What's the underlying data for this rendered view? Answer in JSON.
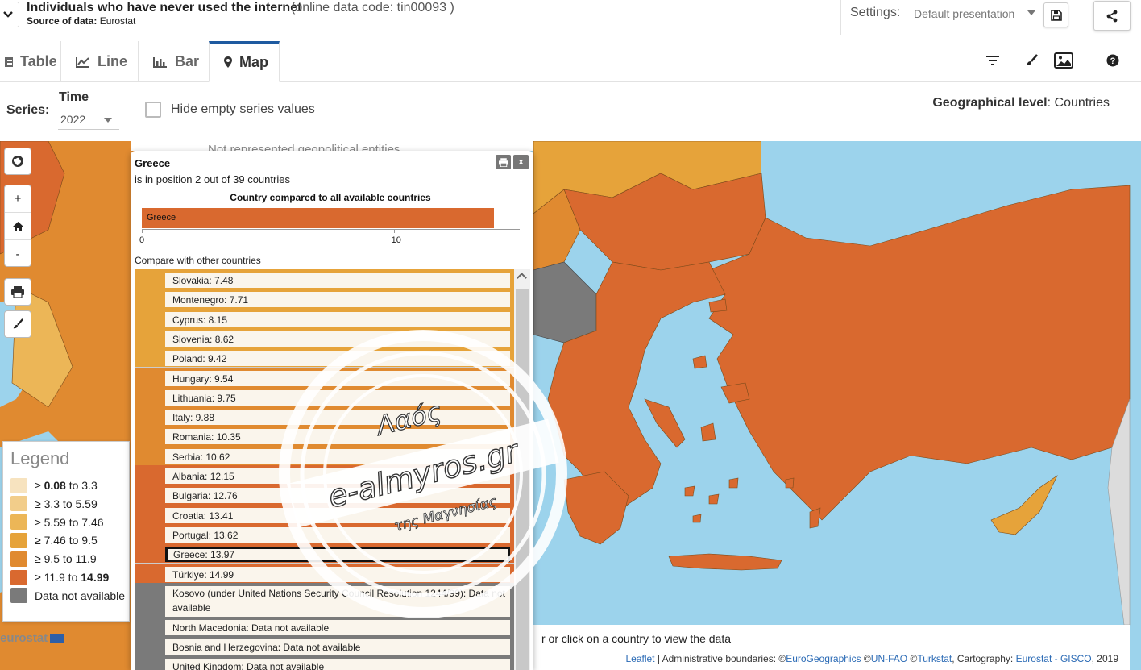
{
  "header": {
    "dataset_title": "Individuals who have never used the internet",
    "dataset_code": "(online data code: tin00093 )",
    "source_label": "Source of data:",
    "source_value": "Eurostat",
    "settings_label": "Settings:",
    "settings_value": "Default presentation"
  },
  "tabs": [
    {
      "label": "Table",
      "icon": "table-icon"
    },
    {
      "label": "Line",
      "icon": "line-chart-icon"
    },
    {
      "label": "Bar",
      "icon": "bar-chart-icon"
    },
    {
      "label": "Map",
      "icon": "map-pin-icon",
      "active": true
    }
  ],
  "toolbar_icons": [
    "filter-icon",
    "brush-icon",
    "image-icon",
    "help-icon"
  ],
  "series_bar": {
    "series_label": "Series:",
    "time_label": "Time",
    "time_value": "2022",
    "hide_empty_label": "Hide empty series values",
    "hide_empty_checked": false,
    "geo_level_label": "Geographical level",
    "geo_level_value": ": Countries"
  },
  "map": {
    "not_represented_text": "Not represented geopolitical entities",
    "hover_hint": "r or click on a country to view the data",
    "attribution": {
      "leaflet": "Leaflet",
      "text1": " | Administrative boundaries: ©",
      "eurogeo": "EuroGeographics",
      "text2": " ©",
      "unfao": "UN-FAO",
      "text3": " ©",
      "turkstat": "Turkstat",
      "text4": ", Cartography: ",
      "gisco": "Eurostat - GISCO",
      "text5": ", 2019"
    },
    "logo_text": "eurostat",
    "controls": {
      "zoom_in": "+",
      "zoom_out": "-"
    }
  },
  "legend": {
    "title": "Legend",
    "items": [
      {
        "prefix": "≥ ",
        "bold_from": "0.08",
        "middle": " to 3.3",
        "bold_to": "",
        "color": "#f7e3bf"
      },
      {
        "prefix": "≥ ",
        "bold_from": "",
        "middle": "3.3 to 5.59",
        "bold_to": "",
        "color": "#f2cd8a"
      },
      {
        "prefix": "≥ ",
        "bold_from": "",
        "middle": "5.59 to 7.46",
        "bold_to": "",
        "color": "#ecb657"
      },
      {
        "prefix": "≥ ",
        "bold_from": "",
        "middle": "7.46 to 9.5",
        "bold_to": "",
        "color": "#e6a33a"
      },
      {
        "prefix": "≥ ",
        "bold_from": "",
        "middle": "9.5 to 11.9",
        "bold_to": "",
        "color": "#e08a30"
      },
      {
        "prefix": "≥ ",
        "bold_from": "",
        "middle": "11.9 to ",
        "bold_to": "14.99",
        "color": "#d9692f"
      },
      {
        "prefix": "",
        "bold_from": "",
        "middle": "Data not available",
        "bold_to": "",
        "color": "#7a7a7a"
      }
    ]
  },
  "popup": {
    "country": "Greece",
    "rank_text": "is in position 2 out of 39 countries",
    "compare_title": "Country compared to all available countries",
    "bar_label": "Greece",
    "bar_value": 13.97,
    "axis_max": 15,
    "ticks": [
      {
        "value": 0,
        "label": "0"
      },
      {
        "value": 10,
        "label": "10"
      }
    ],
    "other_title": "Compare with other countries",
    "list": [
      {
        "label": "Slovakia: 7.48",
        "color": "#e6a33a"
      },
      {
        "label": "Montenegro: 7.71",
        "color": "#e6a33a"
      },
      {
        "label": "Cyprus: 8.15",
        "color": "#e6a33a"
      },
      {
        "label": "Slovenia: 8.62",
        "color": "#e6a33a"
      },
      {
        "label": "Poland: 9.42",
        "color": "#e6a33a"
      },
      {
        "label": "Hungary: 9.54",
        "color": "#e08a30"
      },
      {
        "label": "Lithuania: 9.75",
        "color": "#e08a30"
      },
      {
        "label": "Italy: 9.88",
        "color": "#e08a30"
      },
      {
        "label": "Romania: 10.35",
        "color": "#e08a30"
      },
      {
        "label": "Serbia: 10.62",
        "color": "#e08a30"
      },
      {
        "label": "Albania: 12.15",
        "color": "#d9692f"
      },
      {
        "label": "Bulgaria: 12.76",
        "color": "#d9692f"
      },
      {
        "label": "Croatia: 13.41",
        "color": "#d9692f"
      },
      {
        "label": "Portugal: 13.62",
        "color": "#d9692f"
      },
      {
        "label": "Greece: 13.97",
        "color": "#d9692f",
        "selected": true
      },
      {
        "label": "Türkiye: 14.99",
        "color": "#d9692f"
      },
      {
        "label": "Kosovo (under United Nations Security Council Resolution 1244/99): Data not available",
        "color": "#7a7a7a",
        "tall": true
      },
      {
        "label": "North Macedonia: Data not available",
        "color": "#7a7a7a"
      },
      {
        "label": "Bosnia and Herzegovina: Data not available",
        "color": "#7a7a7a"
      },
      {
        "label": "United Kingdom: Data not available",
        "color": "#7a7a7a"
      }
    ]
  },
  "watermark": {
    "line1": "Λαός",
    "line2": "e-almyros.gr",
    "line3": "της Μαγνησίας"
  }
}
